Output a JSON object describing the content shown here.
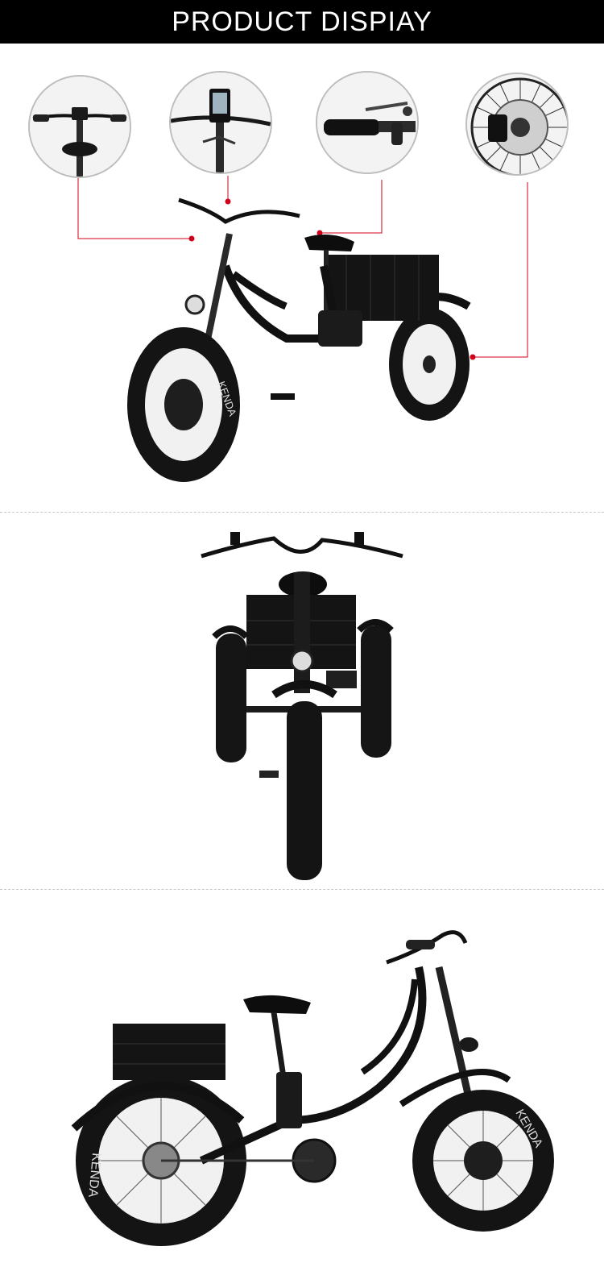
{
  "banner": {
    "title": "PRODUCT DISPIAY"
  },
  "details": [
    {
      "icon": "handlebar-icon"
    },
    {
      "icon": "display-meter-icon"
    },
    {
      "icon": "throttle-grip-icon"
    },
    {
      "icon": "disc-brake-icon"
    }
  ],
  "tire_brand": "KENDA",
  "colors": {
    "banner": "#000000",
    "callout_line": "#d0021b",
    "frame": "#111111"
  }
}
